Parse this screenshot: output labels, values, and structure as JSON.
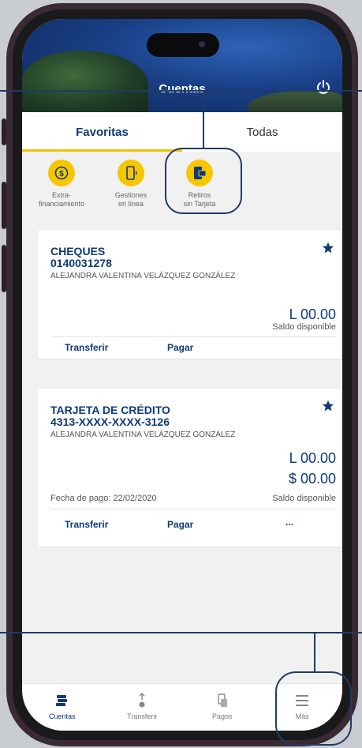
{
  "header": {
    "title": "Cuentas"
  },
  "tabs": [
    {
      "label": "Favoritas",
      "active": true
    },
    {
      "label": "Todas",
      "active": false
    }
  ],
  "quick_actions": [
    {
      "line1": "Extra-",
      "line2": "financiamiento",
      "icon": "money-plus-icon"
    },
    {
      "line1": "Gestiones",
      "line2": "en línea",
      "icon": "mobile-signal-icon"
    },
    {
      "line1": "Retiros",
      "line2": "sin Tarjeta",
      "icon": "mobile-card-icon"
    }
  ],
  "cards": [
    {
      "title": "CHEQUES",
      "number": "0140031278",
      "owner": "ALEJANDRA VALENTINA VELÁZQUEZ GONZÁLEZ",
      "amount1": "L 00.00",
      "sub": "Saldo disponible",
      "actions": [
        "Transferir",
        "Pagar"
      ]
    },
    {
      "title": "TARJETA DE CRÉDITO",
      "number": "4313-XXXX-XXXX-3126",
      "owner": "ALEJANDRA VALENTINA VELÁZQUEZ GONZÁLEZ",
      "amount1": "L 00.00",
      "amount2": "$ 00.00",
      "date": "Fecha de pago: 22/02/2020",
      "sub": "Saldo disponible",
      "actions": [
        "Transferir",
        "Pagar",
        "..."
      ]
    }
  ],
  "bottom_nav": [
    {
      "label": "Cuentas",
      "icon": "accounts-icon",
      "active": true
    },
    {
      "label": "Transferir",
      "icon": "transfer-icon",
      "active": false
    },
    {
      "label": "Pagos",
      "icon": "payments-icon",
      "active": false
    },
    {
      "label": "Más",
      "icon": "menu-icon",
      "active": false
    }
  ],
  "colors": {
    "primary": "#0d3a78",
    "accent": "#f2c300",
    "background": "#f1f1f1"
  }
}
